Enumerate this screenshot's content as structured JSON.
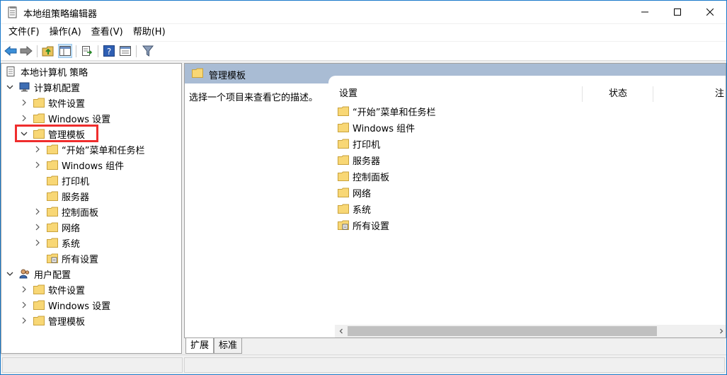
{
  "window": {
    "title": "本地组策略编辑器"
  },
  "menu": [
    {
      "label": "文件(F)"
    },
    {
      "label": "操作(A)"
    },
    {
      "label": "查看(V)"
    },
    {
      "label": "帮助(H)"
    }
  ],
  "toolbar": {
    "buttons": [
      "back-icon",
      "forward-icon",
      "up-folder-icon",
      "show-hide-tree-icon",
      "export-list-icon",
      "help-icon",
      "properties-pane-icon",
      "filter-icon"
    ]
  },
  "tree": {
    "root": "本地计算机 策略",
    "computer_config": "计算机配置",
    "computer_children": [
      "软件设置",
      "Windows 设置",
      "管理模板"
    ],
    "admin_children": [
      "“开始”菜单和任务栏",
      "Windows 组件",
      "打印机",
      "服务器",
      "控制面板",
      "网络",
      "系统",
      "所有设置"
    ],
    "user_config": "用户配置",
    "user_children": [
      "软件设置",
      "Windows 设置",
      "管理模板"
    ]
  },
  "right": {
    "header_title": "管理模板",
    "description": "选择一个项目来查看它的描述。",
    "columns": [
      "设置",
      "状态",
      "注"
    ],
    "items": [
      "“开始”菜单和任务栏",
      "Windows 组件",
      "打印机",
      "服务器",
      "控制面板",
      "网络",
      "系统",
      "所有设置"
    ]
  },
  "tabs": [
    "扩展",
    "标准"
  ],
  "colors": {
    "folder": "#f8d775",
    "header_band": "#a9bcd4",
    "highlight": "#ef2d2d",
    "accent": "#1979ca"
  }
}
